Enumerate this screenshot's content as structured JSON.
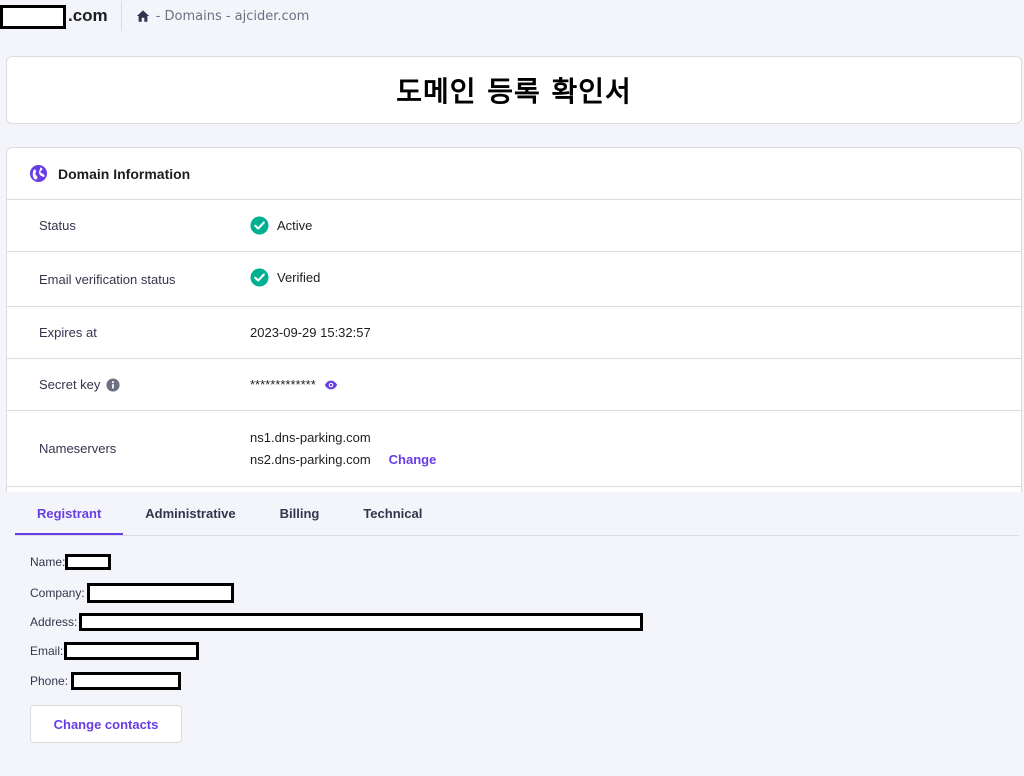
{
  "brand": {
    "suffix": ".com"
  },
  "breadcrumb": {
    "text": "- Domains - ajcider.com"
  },
  "page_title": "도메인 등록 확인서",
  "domain_info": {
    "title": "Domain Information",
    "rows": {
      "status": {
        "label": "Status",
        "value": "Active"
      },
      "email_verification": {
        "label": "Email verification status",
        "value": "Verified"
      },
      "expires": {
        "label": "Expires at",
        "value": "2023-09-29 15:32:57"
      },
      "secret_key": {
        "label": "Secret key",
        "value": "*************"
      },
      "nameservers": {
        "label": "Nameservers",
        "ns1": "ns1.dns-parking.com",
        "ns2": "ns2.dns-parking.com",
        "change_label": "Change"
      }
    }
  },
  "tabs": [
    "Registrant",
    "Administrative",
    "Billing",
    "Technical"
  ],
  "contacts": {
    "name_label": "Name:",
    "company_label": "Company:",
    "address_label": "Address:",
    "email_label": "Email:",
    "phone_label": "Phone:"
  },
  "change_contacts_label": "Change contacts",
  "colors": {
    "accent": "#673de6",
    "success": "#00b090"
  },
  "icons": [
    "home-icon",
    "globe-icon",
    "check-circle-icon",
    "info-icon",
    "eye-icon"
  ]
}
